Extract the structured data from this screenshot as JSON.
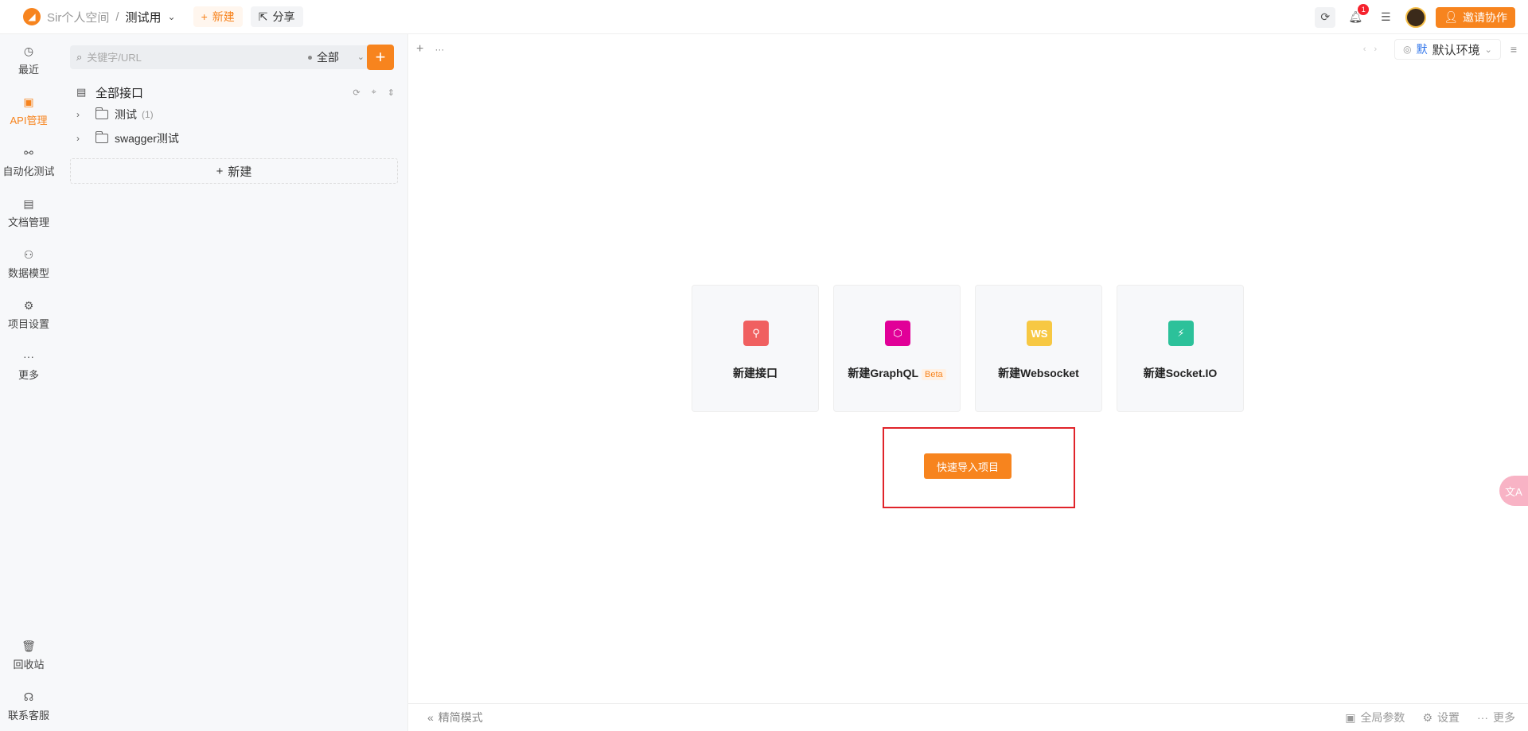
{
  "topbar": {
    "workspace": "Sir个人空间",
    "separator": "/",
    "project": "测试用",
    "new_label": "新建",
    "share_label": "分享",
    "notification_count": "1",
    "invite_label": "邀请协作"
  },
  "rail": {
    "items": [
      {
        "label": "最近",
        "icon": "clock-icon"
      },
      {
        "label": "API管理",
        "icon": "api-icon",
        "active": true
      },
      {
        "label": "自动化测试",
        "icon": "automation-icon"
      },
      {
        "label": "文档管理",
        "icon": "document-icon"
      },
      {
        "label": "数据模型",
        "icon": "data-model-icon"
      },
      {
        "label": "项目设置",
        "icon": "settings-icon"
      },
      {
        "label": "更多",
        "icon": "more-icon"
      }
    ],
    "bottom": [
      {
        "label": "回收站",
        "icon": "trash-icon"
      },
      {
        "label": "联系客服",
        "icon": "headset-icon"
      }
    ]
  },
  "panel": {
    "search_placeholder": "关键字/URL",
    "filter_label": "全部",
    "tree_root": "全部接口",
    "folders": [
      {
        "name": "测试",
        "count": "(1)"
      },
      {
        "name": "swagger测试",
        "count": ""
      }
    ],
    "new_label": "新建"
  },
  "env": {
    "tag": "默",
    "name": "默认环境"
  },
  "cards": [
    {
      "label": "新建接口",
      "color": "#f06060",
      "icon": "link-icon"
    },
    {
      "label": "新建GraphQL",
      "beta": "Beta",
      "color": "#e10098",
      "icon": "graphql-icon"
    },
    {
      "label": "新建Websocket",
      "glyph": "WS",
      "color": "#f7c843",
      "icon": "websocket-icon"
    },
    {
      "label": "新建Socket.IO",
      "color": "#2cc19a",
      "icon": "socketio-icon"
    }
  ],
  "quick_import": "快速导入项目",
  "bottombar": {
    "compact": "精简模式",
    "global_params": "全局参数",
    "settings": "设置",
    "more": "更多"
  },
  "colors": {
    "accent": "#f7841e",
    "highlight": "#e0242a"
  }
}
